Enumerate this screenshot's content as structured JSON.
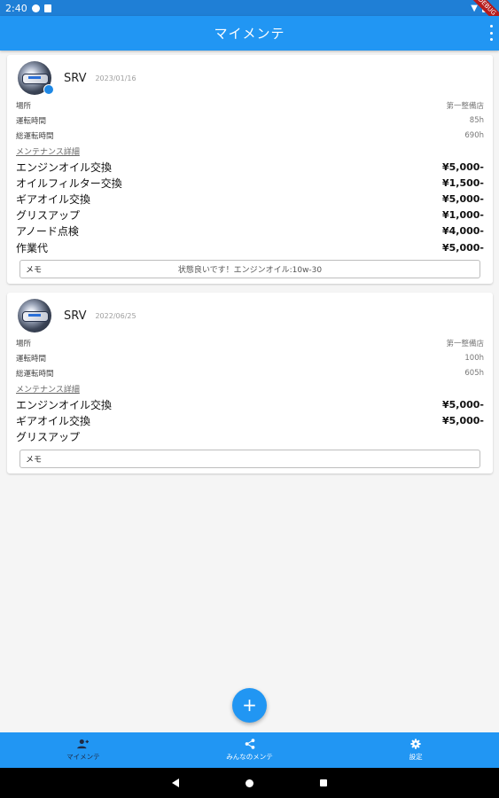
{
  "status_bar": {
    "time": "2:40"
  },
  "debug_banner": "DEBUG",
  "app_bar": {
    "title": "マイメンテ"
  },
  "records": [
    {
      "vehicle": "SRV",
      "date": "2023/01/16",
      "info": [
        {
          "label": "場所",
          "value": "第一整備店"
        },
        {
          "label": "運転時間",
          "value": "85h"
        },
        {
          "label": "総運転時間",
          "value": "690h"
        }
      ],
      "section_label": "メンテナンス詳細",
      "items": [
        {
          "name": "エンジンオイル交換",
          "price": "¥5,000-"
        },
        {
          "name": "オイルフィルター交換",
          "price": "¥1,500-"
        },
        {
          "name": "ギアオイル交換",
          "price": "¥5,000-"
        },
        {
          "name": "グリスアップ",
          "price": "¥1,000-"
        },
        {
          "name": "アノード点検",
          "price": "¥4,000-"
        },
        {
          "name": "作業代",
          "price": "¥5,000-"
        }
      ],
      "memo_label": "メモ",
      "memo_text": "状態良いです！エンジンオイル:10w-30"
    },
    {
      "vehicle": "SRV",
      "date": "2022/06/25",
      "info": [
        {
          "label": "場所",
          "value": "第一整備店"
        },
        {
          "label": "運転時間",
          "value": "100h"
        },
        {
          "label": "総運転時間",
          "value": "605h"
        }
      ],
      "section_label": "メンテナンス詳細",
      "items": [
        {
          "name": "エンジンオイル交換",
          "price": "¥5,000-"
        },
        {
          "name": "ギアオイル交換",
          "price": "¥5,000-"
        },
        {
          "name": "グリスアップ",
          "price": ""
        }
      ],
      "memo_label": "メモ",
      "memo_text": ""
    }
  ],
  "fab_label": "+",
  "bottom_nav": [
    {
      "label": "マイメンテ",
      "icon": "person-add-icon",
      "active": true
    },
    {
      "label": "みんなのメンテ",
      "icon": "share-icon",
      "active": false
    },
    {
      "label": "設定",
      "icon": "gear-icon",
      "active": false
    }
  ],
  "colors": {
    "primary": "#2196f3",
    "status_bar": "#1f7fd6",
    "active_nav_label": "#1f2a44"
  }
}
